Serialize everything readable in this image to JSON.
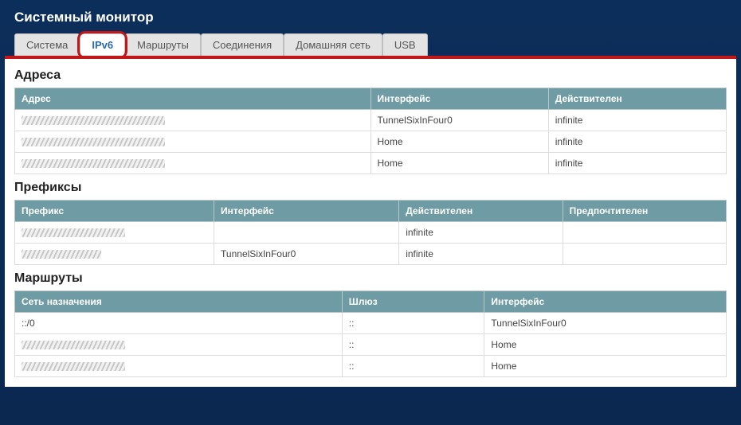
{
  "page_title": "Системный монитор",
  "tabs": [
    {
      "label": "Система",
      "active": false
    },
    {
      "label": "IPv6",
      "active": true
    },
    {
      "label": "Маршруты",
      "active": false
    },
    {
      "label": "Соединения",
      "active": false
    },
    {
      "label": "Домашняя сеть",
      "active": false
    },
    {
      "label": "USB",
      "active": false
    }
  ],
  "sections": {
    "addresses": {
      "title": "Адреса",
      "headers": [
        "Адрес",
        "Интерфейс",
        "Действителен"
      ],
      "rows": [
        {
          "address": "",
          "interface": "TunnelSixInFour0",
          "valid": "infinite"
        },
        {
          "address": "",
          "interface": "Home",
          "valid": "infinite"
        },
        {
          "address": "",
          "interface": "Home",
          "valid": "infinite"
        }
      ]
    },
    "prefixes": {
      "title": "Префиксы",
      "headers": [
        "Префикс",
        "Интерфейс",
        "Действителен",
        "Предпочтителен"
      ],
      "rows": [
        {
          "prefix": "",
          "interface": "",
          "valid": "infinite",
          "preferred": ""
        },
        {
          "prefix": "",
          "interface": "TunnelSixInFour0",
          "valid": "infinite",
          "preferred": ""
        }
      ]
    },
    "routes": {
      "title": "Маршруты",
      "headers": [
        "Сеть назначения",
        "Шлюз",
        "Интерфейс"
      ],
      "rows": [
        {
          "dest": "::/0",
          "gateway": "::",
          "interface": "TunnelSixInFour0"
        },
        {
          "dest": "",
          "gateway": "::",
          "interface": "Home"
        },
        {
          "dest": "",
          "gateway": "::",
          "interface": "Home"
        }
      ]
    }
  }
}
